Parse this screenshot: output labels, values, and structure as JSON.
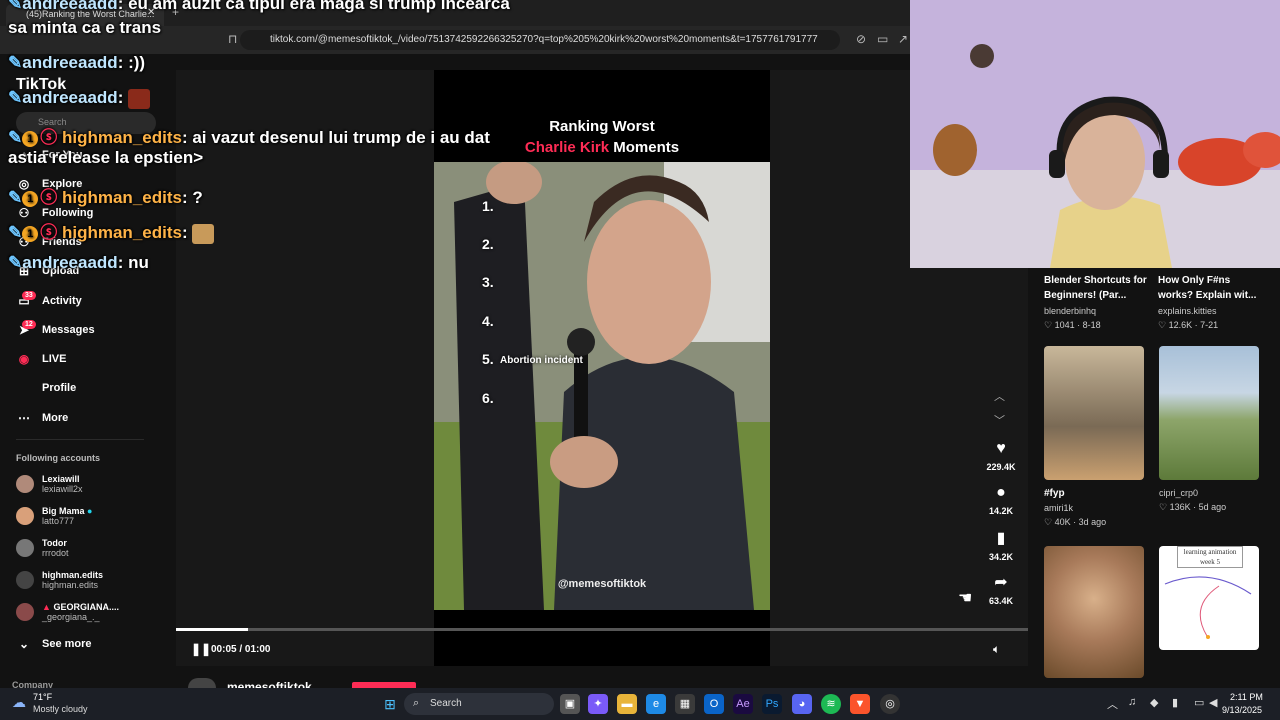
{
  "browser": {
    "tab_title": "(45)Ranking the Worst Charlie...",
    "tab_close": "✕",
    "new_tab": "+",
    "url": "tiktok.com/@memesoftiktok_/video/7513742592266325270?q=top%205%20kirk%20worst%20moments&t=1757761791777"
  },
  "sidebar": {
    "logo": "TikTok",
    "search_placeholder": "Search",
    "items": [
      {
        "label": "For You"
      },
      {
        "label": "Explore"
      },
      {
        "label": "Following"
      },
      {
        "label": "Friends"
      },
      {
        "label": "Upload"
      },
      {
        "label": "Activity",
        "badge": "33"
      },
      {
        "label": "Messages",
        "badge": "12"
      },
      {
        "label": "LIVE"
      },
      {
        "label": "Profile"
      },
      {
        "label": "More"
      }
    ],
    "following_title": "Following accounts",
    "accounts": [
      {
        "name": "Lexiawill",
        "handle": "lexiawill2x"
      },
      {
        "name": "Big Mama",
        "handle": "latto777"
      },
      {
        "name": "Todor",
        "handle": "rrrodot"
      },
      {
        "name": "highman.edits",
        "handle": "highman.edits"
      },
      {
        "name": "GEORGIANA....",
        "handle": "_georgiana_._"
      }
    ],
    "see_more": "See more",
    "company": "Company"
  },
  "video": {
    "title_line1": "Ranking Worst",
    "title_line2_red": "Charlie Kirk",
    "title_line2_white": "Moments",
    "ranks": [
      "1.",
      "2.",
      "3.",
      "4.",
      "5.",
      "6."
    ],
    "rank5_label": "Abortion incident",
    "watermark": "@memesoftiktok",
    "timecode": "00:05 / 01:00",
    "progress": 0.085,
    "author": "memesoftiktok"
  },
  "actions": {
    "likes": "229.4K",
    "comments": "14.2K",
    "saves": "34.2K",
    "shares": "63.4K"
  },
  "recommendations": [
    {
      "title": "Blender Shortcuts for Beginners! (Par...",
      "author": "blenderbinhq",
      "stat": "♡ 1041 · 8-18"
    },
    {
      "title": "How Only F#ns works? Explain wit...",
      "author": "explains.kitties",
      "stat": "♡ 12.6K · 7-21"
    },
    {
      "title": "#fyp",
      "author": "amiri1k",
      "stat": "♡ 40K · 3d ago"
    },
    {
      "title": "",
      "author": "cipri_crp0",
      "stat": "♡ 136K · 5d ago"
    },
    {
      "title": "learning animation week 5",
      "author": "",
      "stat": ""
    }
  ],
  "chat": [
    {
      "user": "andreeaadd",
      "text": "eu am auzit ca tipul era maga si trump incearca"
    },
    {
      "user": "",
      "text": "sa minta ca e trans"
    },
    {
      "user": "andreeaadd",
      "text": ":))"
    },
    {
      "user": "andreeaadd",
      "text": ""
    },
    {
      "user": "highman_edits",
      "text": "ai vazut desenul lui trump de i au dat"
    },
    {
      "user": "",
      "text": "astia release la epstien>"
    },
    {
      "user": "highman_edits",
      "text": "?"
    },
    {
      "user": "highman_edits",
      "text": ""
    },
    {
      "user": "andreeaadd",
      "text": "nu"
    }
  ],
  "taskbar": {
    "temp": "71°F",
    "weather": "Mostly cloudy",
    "search": "Search",
    "time": "2:11 PM",
    "date": "9/13/2025"
  },
  "colors": {
    "tiktok_red": "#fe2c55",
    "chat_user_a": "#bfe6ff",
    "chat_user_b": "#ffb347"
  }
}
